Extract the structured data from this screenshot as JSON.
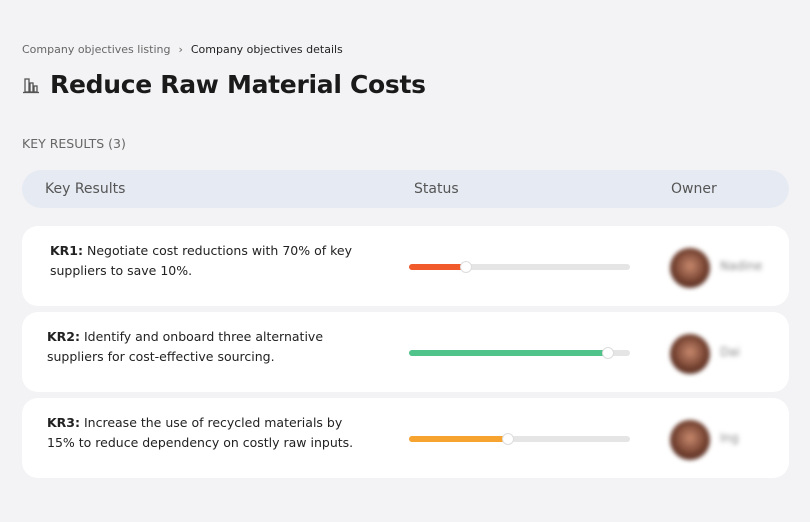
{
  "breadcrumb": {
    "items": [
      "Company objectives listing",
      "Company objectives details"
    ],
    "separator": "›"
  },
  "page": {
    "title": "Reduce Raw Material Costs",
    "icon": "building-chart-icon"
  },
  "section_label": "KEY RESULTS (3)",
  "table": {
    "headers": {
      "key_results": "Key Results",
      "status": "Status",
      "owner": "Owner"
    },
    "rows": [
      {
        "id": "KR1:",
        "text": " Negotiate cost reductions with 70% of key suppliers to save 10%.",
        "progress_percent": 26,
        "color": "#f15a2b",
        "owner": "Nadine"
      },
      {
        "id": "KR2:",
        "text": " Identify and onboard three alternative suppliers for cost-effective sourcing.",
        "progress_percent": 90,
        "color": "#4fc38a",
        "owner": "Dai"
      },
      {
        "id": "KR3:",
        "text": " Increase the use of recycled materials by 15% to reduce dependency on costly raw inputs.",
        "progress_percent": 45,
        "color": "#f7a330",
        "owner": "Ing"
      }
    ]
  }
}
